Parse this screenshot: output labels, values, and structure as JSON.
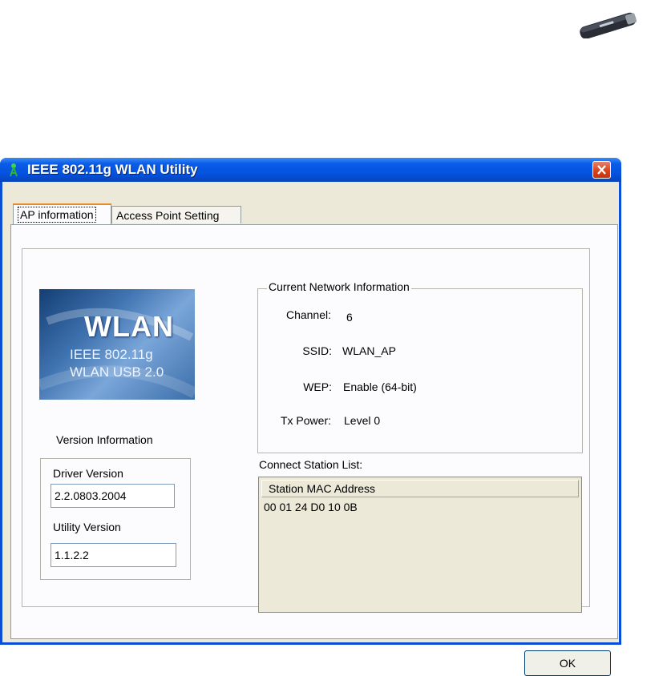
{
  "window": {
    "title": "IEEE 802.11g WLAN Utility"
  },
  "tabs": [
    {
      "label": "AP information"
    },
    {
      "label": "Access Point Setting"
    }
  ],
  "logo": {
    "title": "WLAN",
    "line1": "IEEE 802.11g",
    "line2": "WLAN USB 2.0"
  },
  "version": {
    "section_title": "Version Information",
    "driver_label": "Driver Version",
    "driver_value": "2.2.0803.2004",
    "utility_label": "Utility Version",
    "utility_value": "1.1.2.2"
  },
  "network": {
    "group_title": "Current Network Information",
    "rows": [
      {
        "label": "Channel:",
        "value": "6"
      },
      {
        "label": "SSID:",
        "value": "WLAN_AP"
      },
      {
        "label": "WEP:",
        "value": "Enable (64-bit)"
      },
      {
        "label": "Tx Power:",
        "value": "Level 0"
      }
    ]
  },
  "stations": {
    "label": "Connect Station List:",
    "column_header": "Station MAC Address",
    "rows": [
      "00 01 24 D0 10 0B"
    ]
  },
  "buttons": {
    "ok": "OK"
  },
  "colors": {
    "titlebar": "#0451dd",
    "dialog_bg": "#ece9d8",
    "close": "#d8441c"
  }
}
